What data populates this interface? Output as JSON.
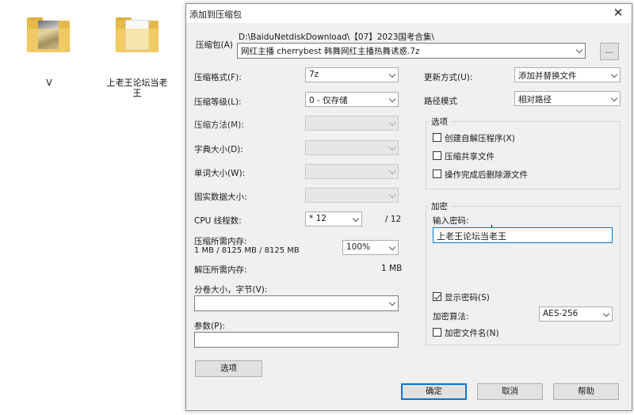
{
  "desktop": {
    "icons": [
      {
        "label": "V"
      },
      {
        "label": "上老王论坛当老王"
      }
    ]
  },
  "dialog": {
    "title": "添加到压缩包",
    "archive": {
      "label": "压缩包(A)",
      "path": "D:\\BaiduNetdiskDownload\\【07】2023国考合集\\",
      "filename": "网红主播 cherrybest 韩舞网红主播热舞诱惑.7z",
      "browse_label": "..."
    },
    "left": {
      "format": {
        "label": "压缩格式(F):",
        "value": "7z"
      },
      "level": {
        "label": "压缩等级(L):",
        "value": "0 - 仅存储"
      },
      "method": {
        "label": "压缩方法(M):",
        "value": ""
      },
      "dict": {
        "label": "字典大小(D):",
        "value": ""
      },
      "word": {
        "label": "单词大小(W):",
        "value": ""
      },
      "solid": {
        "label": "固实数据大小:",
        "value": ""
      },
      "threads": {
        "label": "CPU 线程数:",
        "value": "* 12",
        "max": "/ 12"
      },
      "mem_compress": {
        "label": "压缩所需内存:",
        "detail": "1 MB / 8125 MB / 8125 MB",
        "percent": "100%"
      },
      "mem_decompress": {
        "label": "解压所需内存:",
        "value": "1 MB"
      },
      "volume": {
        "label": "分卷大小，字节(V):",
        "value": ""
      },
      "params": {
        "label": "参数(P):",
        "value": ""
      },
      "options_button": "选项"
    },
    "right": {
      "update": {
        "label": "更新方式(U):",
        "value": "添加并替换文件"
      },
      "path_mode": {
        "label": "路径模式",
        "value": "相对路径"
      },
      "options_group": {
        "title": "选项",
        "sfx": {
          "label": "创建自解压程序(X)",
          "checked": false
        },
        "shared": {
          "label": "压缩共享文件",
          "checked": false
        },
        "delete": {
          "label": "操作完成后删除源文件",
          "checked": false
        }
      },
      "encryption": {
        "title": "加密",
        "password_label": "输入密码:",
        "password_value": "上老王论坛当老王",
        "show_password": {
          "label": "显示密码(S)",
          "checked": true
        },
        "method_label": "加密算法:",
        "method_value": "AES-256",
        "encrypt_names": {
          "label": "加密文件名(N)",
          "checked": false
        }
      }
    },
    "buttons": {
      "ok": "确定",
      "cancel": "取消",
      "help": "帮助"
    }
  }
}
